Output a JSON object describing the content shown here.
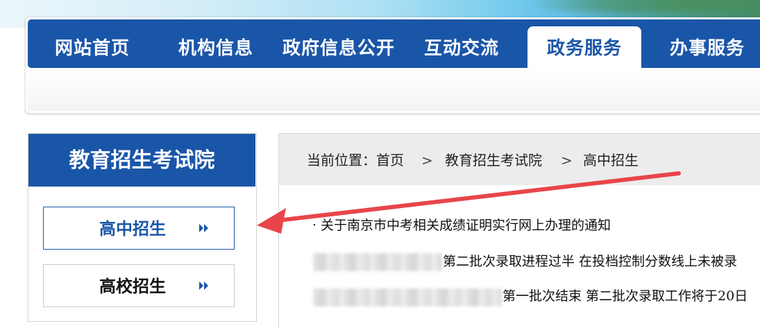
{
  "nav": {
    "items": [
      {
        "label": "网站首页"
      },
      {
        "label": "机构信息"
      },
      {
        "label": "政府信息公开"
      },
      {
        "label": "互动交流"
      },
      {
        "label": "政务服务",
        "active": true
      },
      {
        "label": "办事服务"
      }
    ]
  },
  "sidebar": {
    "title": "教育招生考试院",
    "items": [
      {
        "label": "高中招生",
        "active": true,
        "icon": "double-chevron-right-icon"
      },
      {
        "label": "高校招生",
        "icon": "double-chevron-right-icon"
      }
    ]
  },
  "breadcrumb": {
    "prefix": "当前位置：首页",
    "separator": ">",
    "level2": "教育招生考试院",
    "level3": "高中招生"
  },
  "news": {
    "items": [
      {
        "bullet": "·",
        "title": "关于南京市中考相关成绩证明实行网上办理的通知"
      },
      {
        "title_visible": "第二批次录取进程过半  在投档控制分数线上未被录"
      },
      {
        "title_visible": "第一批次结束  第二批次录取工作将于20日"
      }
    ]
  },
  "colors": {
    "primary": "#1a56a8",
    "annotation_arrow": "#e8454a"
  }
}
